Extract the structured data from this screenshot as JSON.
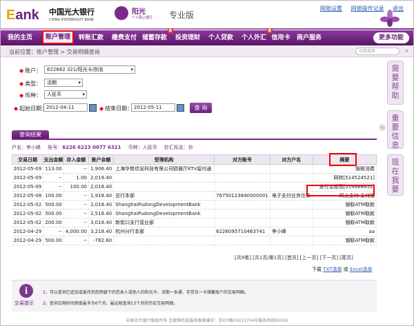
{
  "header": {
    "ebank_e": "E",
    "ebank_rest": "ank",
    "bank_cn": "中国光大银行",
    "bank_en": "CHINA EVERBRIGHT BANK",
    "brand": "阳光",
    "brand_sub": "个人网上银行",
    "edition": "专业版",
    "links": [
      "网银设置",
      "网银操作记录",
      "退出"
    ]
  },
  "nav": {
    "items": [
      {
        "label": "我的主页"
      },
      {
        "label": "账户管理"
      },
      {
        "label": "转账汇款"
      },
      {
        "label": "缴费支付"
      },
      {
        "label": "储蓄存款"
      },
      {
        "label": "投资理财"
      },
      {
        "label": "个人贷款"
      },
      {
        "label": "个人外汇"
      },
      {
        "label": "信用卡"
      },
      {
        "label": "商户服务"
      }
    ],
    "more": "更多功能"
  },
  "crumb": {
    "text": "当前位置：账户管理 > 交易明细查询",
    "search_placeholder": "功能搜索"
  },
  "form": {
    "account_label": "账户：",
    "account_value": "622662       321/阳光卡/别名",
    "type_label": "类型：",
    "type_value": "活期",
    "currency_label": "币种：",
    "currency_value": "人民币",
    "start_label": "起始日期：",
    "start_value": "2012-04-11",
    "end_label": "结束日期：",
    "end_value": "2012-05-11",
    "query": "查 询"
  },
  "side": {
    "help": "需要帮助",
    "info": "重要信息",
    "now": "现在我要",
    "arrow": "‹"
  },
  "result": {
    "tab": "查询结果",
    "owner_label": "户名：",
    "owner": "李小峰",
    "acct_label": "账号：",
    "acct": "6226 6223 0077 6321",
    "cur_label": "币种：",
    "cur": "人民币",
    "flag_label": "钞汇标志：",
    "flag": "钞",
    "columns": [
      "交易日期",
      "支出金额",
      "存入金额",
      "账户余额",
      "受理机构",
      "对方账号",
      "对方户名",
      "摘要"
    ],
    "rows": [
      [
        "2012-05-09",
        "113.00",
        "--",
        "1,906.40",
        "上海华势信息科技有限公司欧雅厅KTV留付通",
        "",
        "",
        "银联消费"
      ],
      [
        "2012-05-09",
        "--",
        "1.00",
        "2,019.40",
        "",
        "",
        "",
        "网转[514524521]"
      ],
      [
        "2012-05-09",
        "--",
        "100.00",
        "2,018.40",
        "",
        "",
        "",
        "支付宝提现[514488452]"
      ],
      [
        "2012-05-08",
        "100.00",
        "--",
        "1,918.40",
        "总行本部",
        "76750123840000001",
        "电子支付业务往来",
        "网上支付 支付宝"
      ],
      [
        "2012-05-02",
        "500.00",
        "--",
        "2,018.40",
        "ShanghaiPudongDevelopmentBank",
        "",
        "",
        "银联ATM取款"
      ],
      [
        "2012-05-02",
        "500.00",
        "--",
        "2,518.40",
        "ShanghaiPudongDevelopmentBank",
        "",
        "",
        "银联ATM取款"
      ],
      [
        "2012-05-02",
        "200.00",
        "--",
        "3,018.40",
        "新街口支行营业部",
        "",
        "",
        "银联ATM取款"
      ],
      [
        "2012-04-29",
        "--",
        "4,000.00",
        "3,218.40",
        "杭州分行本部",
        "6226095710463741",
        "李小峰",
        "aa"
      ],
      [
        "2012-04-29",
        "500.00",
        "--",
        "-782.60",
        "",
        "",
        "",
        "银联ATM取款"
      ]
    ],
    "pager": "[共9笔] [共1页/第1页] [首页] [上一页] [下一页] [尾页]",
    "download_label": "下载",
    "download_txt": "TXT清单",
    "download_and": "或",
    "download_excel": "Excel清单"
  },
  "tips": {
    "icon": "i",
    "label": "交易提示",
    "tip1": "1、可以查询已追加或委托到您网银下的您本人或他人的阳光卡、活期一本通、存贷合一卡储蓄账户的交易明细。",
    "tip2": "2、查询日期时间跨度最多为6个月，最远能查询13个月的历史交易明细。"
  },
  "footer": "中国光大银行版权所有  互联网信息服务备案编号：京ICP备05013704号服务热线95595",
  "colors": {
    "brand": "#7b2a8a",
    "highlight": "#ee0000"
  }
}
